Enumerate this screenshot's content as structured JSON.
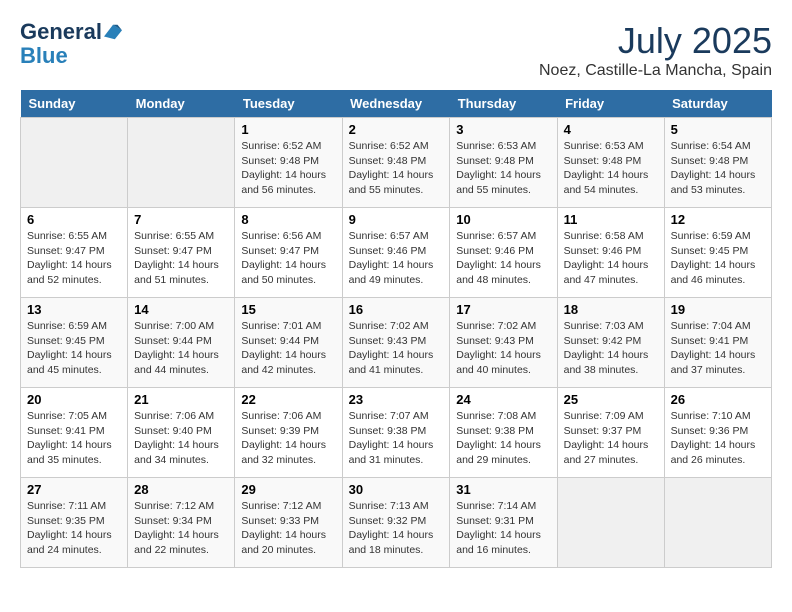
{
  "header": {
    "logo_line1": "General",
    "logo_line2": "Blue",
    "month_year": "July 2025",
    "location": "Noez, Castille-La Mancha, Spain"
  },
  "days_of_week": [
    "Sunday",
    "Monday",
    "Tuesday",
    "Wednesday",
    "Thursday",
    "Friday",
    "Saturday"
  ],
  "weeks": [
    [
      {
        "day": "",
        "empty": true
      },
      {
        "day": "",
        "empty": true
      },
      {
        "day": "1",
        "sunrise": "Sunrise: 6:52 AM",
        "sunset": "Sunset: 9:48 PM",
        "daylight": "Daylight: 14 hours and 56 minutes."
      },
      {
        "day": "2",
        "sunrise": "Sunrise: 6:52 AM",
        "sunset": "Sunset: 9:48 PM",
        "daylight": "Daylight: 14 hours and 55 minutes."
      },
      {
        "day": "3",
        "sunrise": "Sunrise: 6:53 AM",
        "sunset": "Sunset: 9:48 PM",
        "daylight": "Daylight: 14 hours and 55 minutes."
      },
      {
        "day": "4",
        "sunrise": "Sunrise: 6:53 AM",
        "sunset": "Sunset: 9:48 PM",
        "daylight": "Daylight: 14 hours and 54 minutes."
      },
      {
        "day": "5",
        "sunrise": "Sunrise: 6:54 AM",
        "sunset": "Sunset: 9:48 PM",
        "daylight": "Daylight: 14 hours and 53 minutes."
      }
    ],
    [
      {
        "day": "6",
        "sunrise": "Sunrise: 6:55 AM",
        "sunset": "Sunset: 9:47 PM",
        "daylight": "Daylight: 14 hours and 52 minutes."
      },
      {
        "day": "7",
        "sunrise": "Sunrise: 6:55 AM",
        "sunset": "Sunset: 9:47 PM",
        "daylight": "Daylight: 14 hours and 51 minutes."
      },
      {
        "day": "8",
        "sunrise": "Sunrise: 6:56 AM",
        "sunset": "Sunset: 9:47 PM",
        "daylight": "Daylight: 14 hours and 50 minutes."
      },
      {
        "day": "9",
        "sunrise": "Sunrise: 6:57 AM",
        "sunset": "Sunset: 9:46 PM",
        "daylight": "Daylight: 14 hours and 49 minutes."
      },
      {
        "day": "10",
        "sunrise": "Sunrise: 6:57 AM",
        "sunset": "Sunset: 9:46 PM",
        "daylight": "Daylight: 14 hours and 48 minutes."
      },
      {
        "day": "11",
        "sunrise": "Sunrise: 6:58 AM",
        "sunset": "Sunset: 9:46 PM",
        "daylight": "Daylight: 14 hours and 47 minutes."
      },
      {
        "day": "12",
        "sunrise": "Sunrise: 6:59 AM",
        "sunset": "Sunset: 9:45 PM",
        "daylight": "Daylight: 14 hours and 46 minutes."
      }
    ],
    [
      {
        "day": "13",
        "sunrise": "Sunrise: 6:59 AM",
        "sunset": "Sunset: 9:45 PM",
        "daylight": "Daylight: 14 hours and 45 minutes."
      },
      {
        "day": "14",
        "sunrise": "Sunrise: 7:00 AM",
        "sunset": "Sunset: 9:44 PM",
        "daylight": "Daylight: 14 hours and 44 minutes."
      },
      {
        "day": "15",
        "sunrise": "Sunrise: 7:01 AM",
        "sunset": "Sunset: 9:44 PM",
        "daylight": "Daylight: 14 hours and 42 minutes."
      },
      {
        "day": "16",
        "sunrise": "Sunrise: 7:02 AM",
        "sunset": "Sunset: 9:43 PM",
        "daylight": "Daylight: 14 hours and 41 minutes."
      },
      {
        "day": "17",
        "sunrise": "Sunrise: 7:02 AM",
        "sunset": "Sunset: 9:43 PM",
        "daylight": "Daylight: 14 hours and 40 minutes."
      },
      {
        "day": "18",
        "sunrise": "Sunrise: 7:03 AM",
        "sunset": "Sunset: 9:42 PM",
        "daylight": "Daylight: 14 hours and 38 minutes."
      },
      {
        "day": "19",
        "sunrise": "Sunrise: 7:04 AM",
        "sunset": "Sunset: 9:41 PM",
        "daylight": "Daylight: 14 hours and 37 minutes."
      }
    ],
    [
      {
        "day": "20",
        "sunrise": "Sunrise: 7:05 AM",
        "sunset": "Sunset: 9:41 PM",
        "daylight": "Daylight: 14 hours and 35 minutes."
      },
      {
        "day": "21",
        "sunrise": "Sunrise: 7:06 AM",
        "sunset": "Sunset: 9:40 PM",
        "daylight": "Daylight: 14 hours and 34 minutes."
      },
      {
        "day": "22",
        "sunrise": "Sunrise: 7:06 AM",
        "sunset": "Sunset: 9:39 PM",
        "daylight": "Daylight: 14 hours and 32 minutes."
      },
      {
        "day": "23",
        "sunrise": "Sunrise: 7:07 AM",
        "sunset": "Sunset: 9:38 PM",
        "daylight": "Daylight: 14 hours and 31 minutes."
      },
      {
        "day": "24",
        "sunrise": "Sunrise: 7:08 AM",
        "sunset": "Sunset: 9:38 PM",
        "daylight": "Daylight: 14 hours and 29 minutes."
      },
      {
        "day": "25",
        "sunrise": "Sunrise: 7:09 AM",
        "sunset": "Sunset: 9:37 PM",
        "daylight": "Daylight: 14 hours and 27 minutes."
      },
      {
        "day": "26",
        "sunrise": "Sunrise: 7:10 AM",
        "sunset": "Sunset: 9:36 PM",
        "daylight": "Daylight: 14 hours and 26 minutes."
      }
    ],
    [
      {
        "day": "27",
        "sunrise": "Sunrise: 7:11 AM",
        "sunset": "Sunset: 9:35 PM",
        "daylight": "Daylight: 14 hours and 24 minutes."
      },
      {
        "day": "28",
        "sunrise": "Sunrise: 7:12 AM",
        "sunset": "Sunset: 9:34 PM",
        "daylight": "Daylight: 14 hours and 22 minutes."
      },
      {
        "day": "29",
        "sunrise": "Sunrise: 7:12 AM",
        "sunset": "Sunset: 9:33 PM",
        "daylight": "Daylight: 14 hours and 20 minutes."
      },
      {
        "day": "30",
        "sunrise": "Sunrise: 7:13 AM",
        "sunset": "Sunset: 9:32 PM",
        "daylight": "Daylight: 14 hours and 18 minutes."
      },
      {
        "day": "31",
        "sunrise": "Sunrise: 7:14 AM",
        "sunset": "Sunset: 9:31 PM",
        "daylight": "Daylight: 14 hours and 16 minutes."
      },
      {
        "day": "",
        "empty": true
      },
      {
        "day": "",
        "empty": true
      }
    ]
  ]
}
